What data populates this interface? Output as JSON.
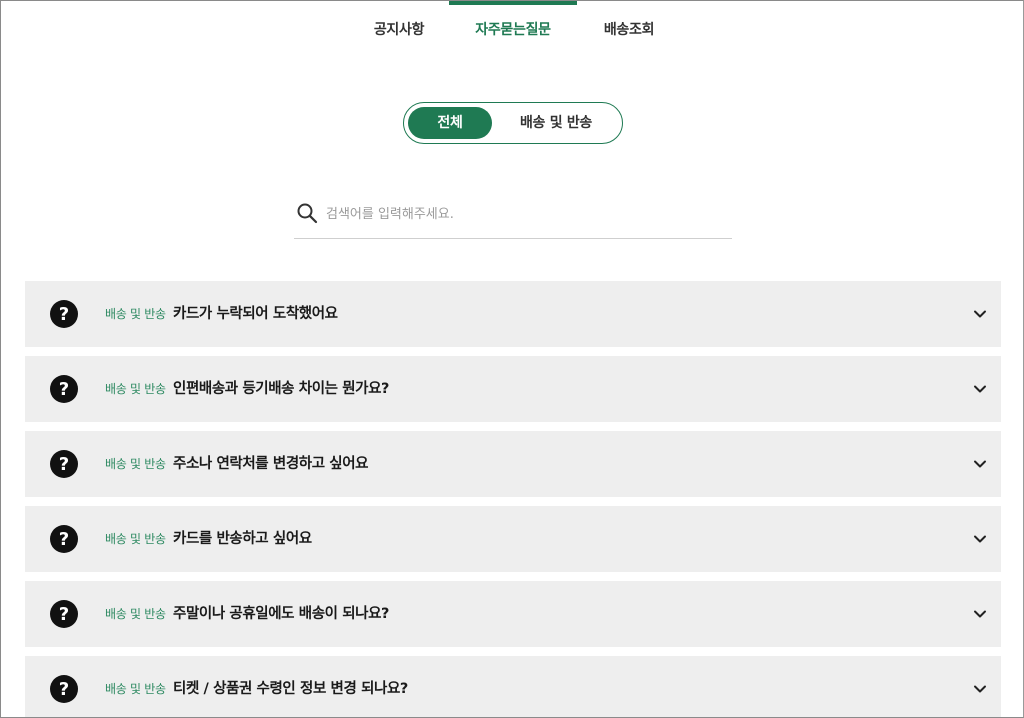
{
  "tabs": [
    {
      "label": "공지사항",
      "active": false
    },
    {
      "label": "자주묻는질문",
      "active": true
    },
    {
      "label": "배송조회",
      "active": false
    }
  ],
  "filter": {
    "all_label": "전체",
    "shipping_label": "배송 및 반송"
  },
  "search": {
    "placeholder": "검색어를 입력해주세요.",
    "icon": "search-icon"
  },
  "faq": [
    {
      "category": "배송 및 반송",
      "question": "카드가 누락되어 도착했어요"
    },
    {
      "category": "배송 및 반송",
      "question": "인편배송과 등기배송 차이는 뭔가요?"
    },
    {
      "category": "배송 및 반송",
      "question": "주소나 연락처를 변경하고 싶어요"
    },
    {
      "category": "배송 및 반송",
      "question": "카드를 반송하고 싶어요"
    },
    {
      "category": "배송 및 반송",
      "question": "주말이나 공휴일에도 배송이 되나요?"
    },
    {
      "category": "배송 및 반송",
      "question": "티켓 / 상품권 수령인 정보 변경 되나요?"
    }
  ],
  "colors": {
    "accent": "#1f7a53",
    "category_text": "#2e8a62",
    "item_bg": "#eeeeee"
  }
}
